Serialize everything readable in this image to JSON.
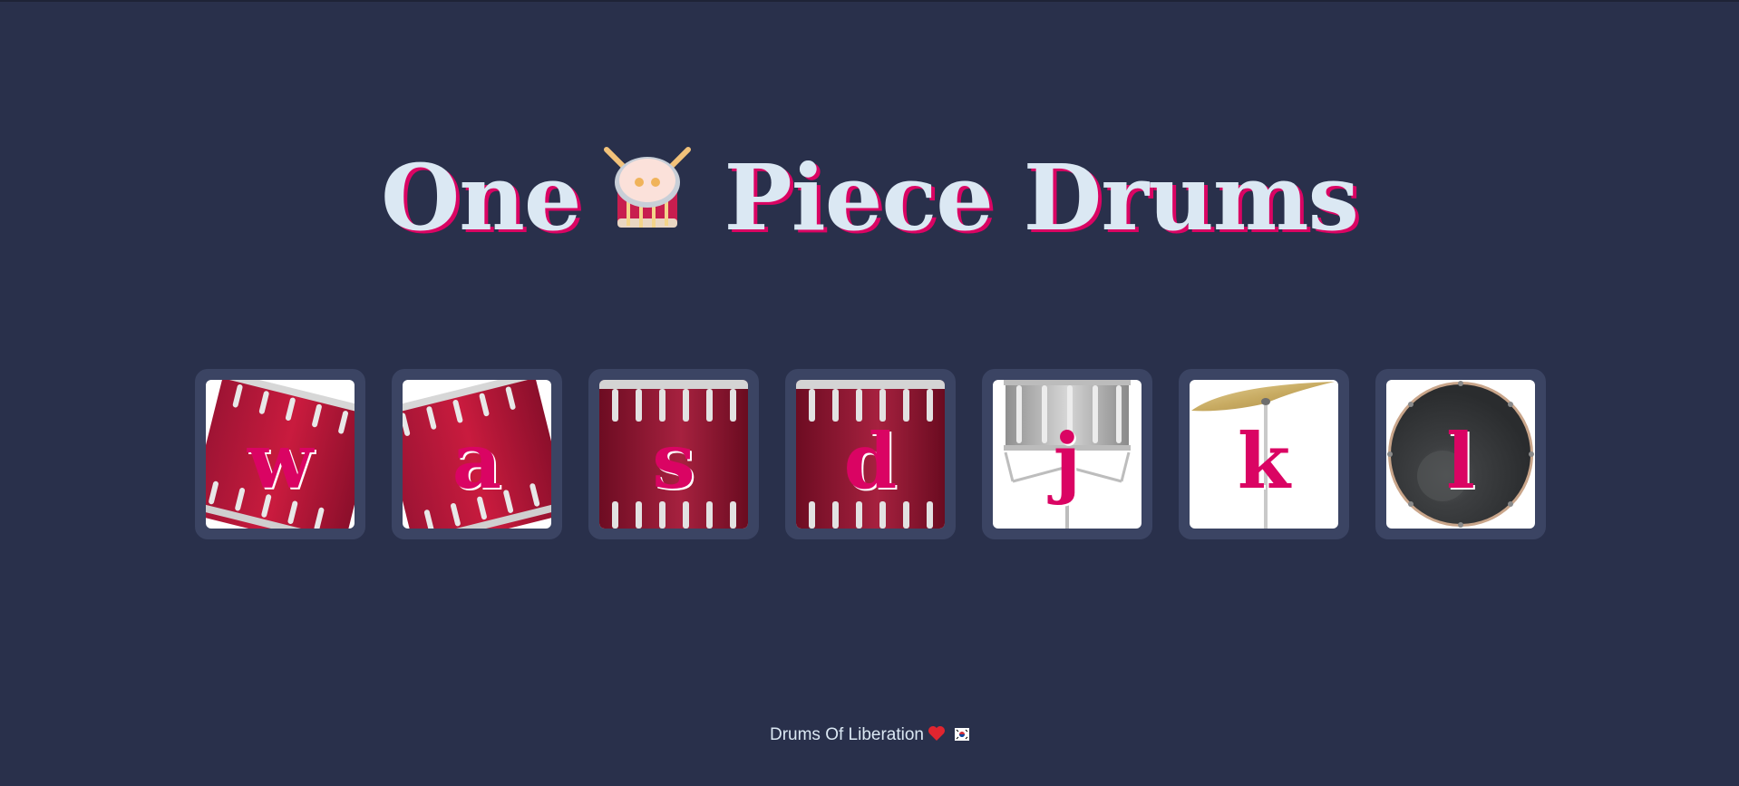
{
  "title": {
    "before": "One",
    "after": "Piece Drums",
    "icon": "drum-icon"
  },
  "keys": [
    {
      "letter": "w",
      "drum": "tom-1",
      "icon": "tom-drum-icon"
    },
    {
      "letter": "a",
      "drum": "tom-2",
      "icon": "tom-drum-icon"
    },
    {
      "letter": "s",
      "drum": "tom-3",
      "icon": "tom-drum-icon"
    },
    {
      "letter": "d",
      "drum": "tom-4",
      "icon": "tom-drum-icon"
    },
    {
      "letter": "j",
      "drum": "snare",
      "icon": "snare-drum-icon"
    },
    {
      "letter": "k",
      "drum": "crash",
      "icon": "cymbal-icon"
    },
    {
      "letter": "l",
      "drum": "kick-bass",
      "icon": "kick-drum-icon"
    }
  ],
  "footer": {
    "text": "Drums Of Liberation",
    "heart_icon": "heart-icon",
    "flag_icon": "flag-icon"
  },
  "colors": {
    "background": "#29304b",
    "key_border": "#3b4463",
    "accent": "#da0463",
    "title_text": "#dbe8f3"
  }
}
